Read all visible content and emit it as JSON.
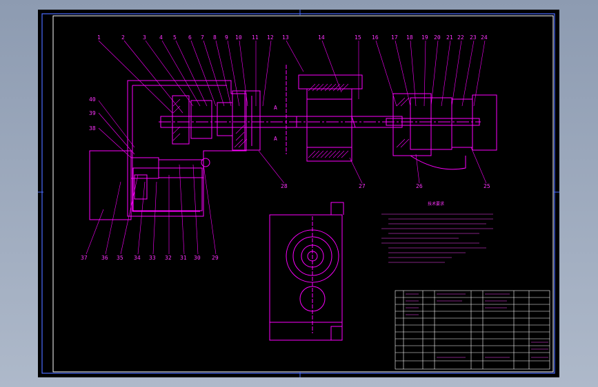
{
  "drawing": {
    "colors": {
      "line": "#ff00ff",
      "frame": "#ffffff",
      "blue": "#4a6bff",
      "background": "#000000",
      "outer": "#9aa7bb"
    },
    "part_labels_top": [
      "1",
      "2",
      "3",
      "4",
      "5",
      "6",
      "7",
      "8",
      "9",
      "10",
      "11",
      "12",
      "13",
      "14",
      "15",
      "16",
      "17",
      "18",
      "19",
      "20",
      "21",
      "22",
      "23",
      "24"
    ],
    "part_labels_left": [
      "40",
      "39",
      "38"
    ],
    "part_labels_right": [
      "28",
      "27",
      "26",
      "25"
    ],
    "part_labels_bottom": [
      "37",
      "36",
      "35",
      "34",
      "33",
      "32",
      "31",
      "30",
      "29"
    ],
    "section_mark": "A",
    "notes_title": "技术要求"
  }
}
